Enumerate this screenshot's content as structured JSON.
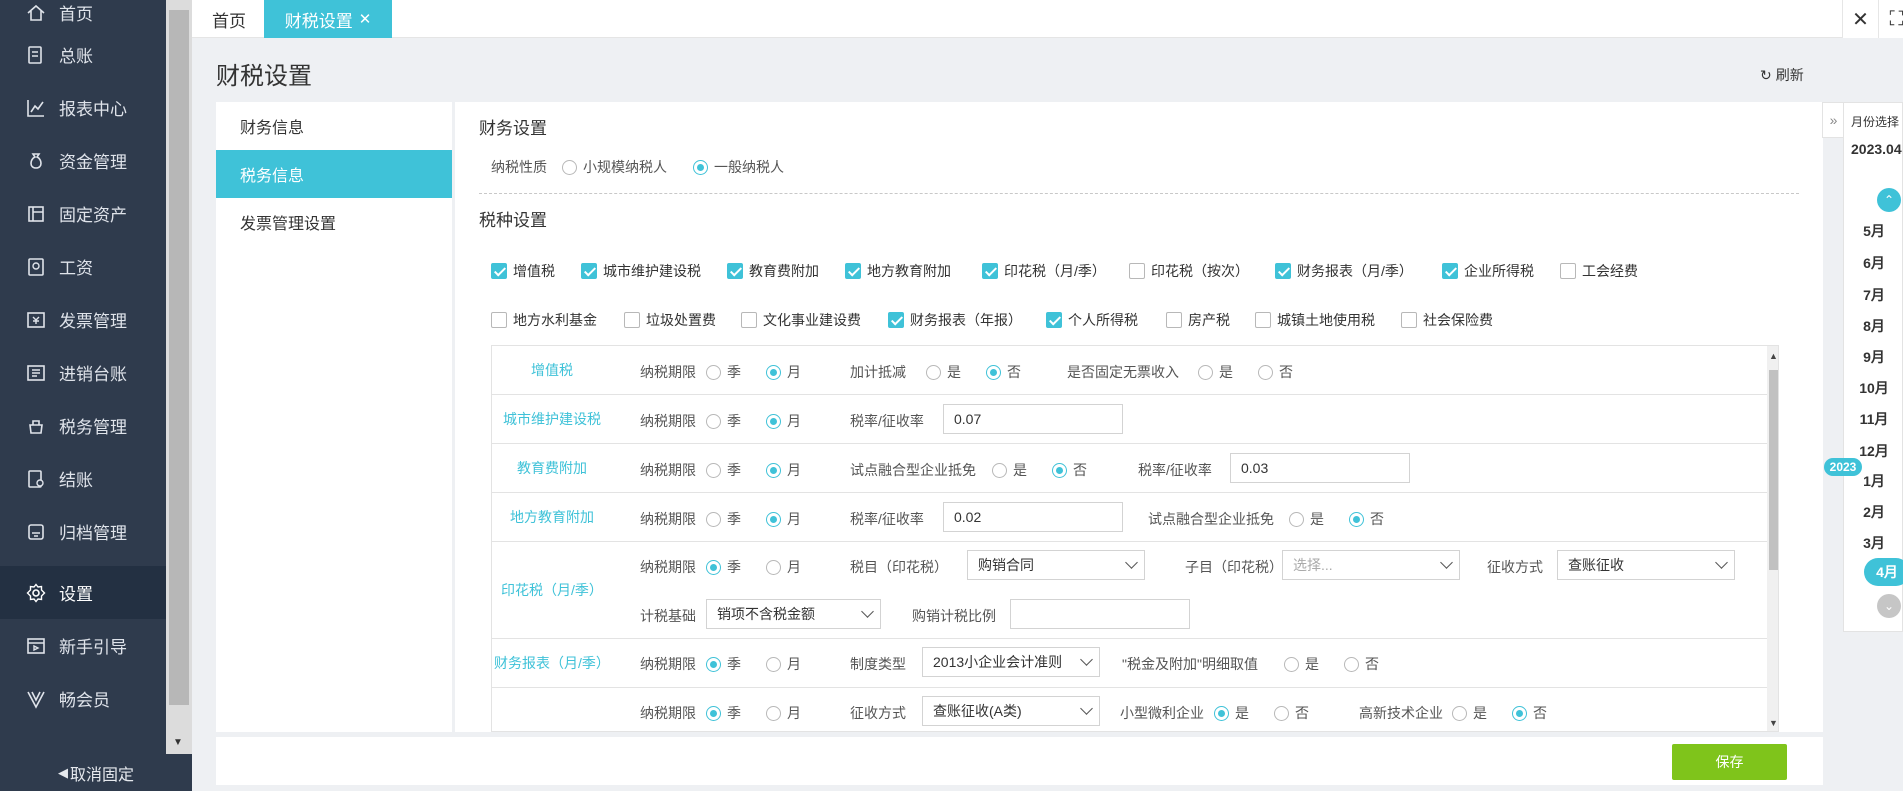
{
  "sidebar": {
    "items": [
      {
        "label": "首页",
        "icon": "home-icon"
      },
      {
        "label": "总账",
        "icon": "ledger-icon"
      },
      {
        "label": "报表中心",
        "icon": "chart-icon"
      },
      {
        "label": "资金管理",
        "icon": "money-bag-icon"
      },
      {
        "label": "固定资产",
        "icon": "asset-icon"
      },
      {
        "label": "工资",
        "icon": "salary-icon"
      },
      {
        "label": "发票管理",
        "icon": "invoice-icon"
      },
      {
        "label": "进销台账",
        "icon": "inventory-icon"
      },
      {
        "label": "税务管理",
        "icon": "tax-icon"
      },
      {
        "label": "结账",
        "icon": "checkout-icon"
      },
      {
        "label": "归档管理",
        "icon": "archive-icon"
      },
      {
        "label": "设置",
        "icon": "gear-icon"
      },
      {
        "label": "新手引导",
        "icon": "guide-icon"
      },
      {
        "label": "畅会员",
        "icon": "vip-icon"
      }
    ],
    "footer": "取消固定"
  },
  "tabs": {
    "home": "首页",
    "active": "财税设置"
  },
  "page": {
    "title": "财税设置",
    "refresh": "刷新"
  },
  "left_nav": [
    "财务信息",
    "税务信息",
    "发票管理设置"
  ],
  "finance": {
    "title": "财务设置",
    "tax_nature_label": "纳税性质",
    "options": [
      "小规模纳税人",
      "一般纳税人"
    ]
  },
  "tax_types": {
    "title": "税种设置",
    "row1": [
      {
        "label": "增值税",
        "checked": true
      },
      {
        "label": "城市维护建设税",
        "checked": true
      },
      {
        "label": "教育费附加",
        "checked": true
      },
      {
        "label": "地方教育附加",
        "checked": true
      },
      {
        "label": "印花税（月/季）",
        "checked": true
      },
      {
        "label": "印花税（按次）",
        "checked": false
      },
      {
        "label": "财务报表（月/季）",
        "checked": true
      },
      {
        "label": "企业所得税",
        "checked": true
      },
      {
        "label": "工会经费",
        "checked": false
      }
    ],
    "row2": [
      {
        "label": "地方水利基金",
        "checked": false
      },
      {
        "label": "垃圾处置费",
        "checked": false
      },
      {
        "label": "文化事业建设费",
        "checked": false
      },
      {
        "label": "财务报表（年报）",
        "checked": true
      },
      {
        "label": "个人所得税",
        "checked": true
      },
      {
        "label": "房产税",
        "checked": false
      },
      {
        "label": "城镇土地使用税",
        "checked": false
      },
      {
        "label": "社会保险费",
        "checked": false
      }
    ]
  },
  "common": {
    "period": "纳税期限",
    "season": "季",
    "month": "月",
    "yes": "是",
    "no": "否",
    "rate": "税率/征收率"
  },
  "rows": {
    "vat": {
      "name": "增值税",
      "plus_deduct": "加计抵减",
      "fixed_no_invoice": "是否固定无票收入"
    },
    "city": {
      "name": "城市维护建设税",
      "rate_value": "0.07"
    },
    "edu": {
      "name": "教育费附加",
      "pilot": "试点融合型企业抵免",
      "rate_value": "0.03"
    },
    "local_edu": {
      "name": "地方教育附加",
      "rate_value": "0.02",
      "pilot": "试点融合型企业抵免"
    },
    "stamp": {
      "name": "印花税（月/季）",
      "item_label": "税目（印花税）",
      "item_value": "购销合同",
      "sub_label": "子目（印花税）",
      "sub_placeholder": "选择...",
      "method_label": "征收方式",
      "method_value": "查账征收",
      "base_label": "计税基础",
      "base_value": "销项不含税金额",
      "ratio_label": "购销计税比例"
    },
    "report": {
      "name": "财务报表（月/季）",
      "system_label": "制度类型",
      "system_value": "2013小企业会计准则",
      "detail_label": "\"税金及附加\"明细取值"
    },
    "cit": {
      "method_label": "征收方式",
      "method_value": "查账征收(A类)",
      "small_label": "小型微利企业",
      "hightech_label": "高新技术企业"
    }
  },
  "month_panel": {
    "title": "月份选择",
    "year": "2023.04",
    "months": [
      "5月",
      "6月",
      "7月",
      "8月",
      "9月",
      "10月",
      "11月",
      "12月",
      "1月",
      "2月",
      "3月",
      "4月"
    ],
    "year_badge": "2023"
  },
  "save": "保存",
  "colors": {
    "accent": "#3fc2d8",
    "sidebar": "#2f3b4d",
    "save": "#7fc41b"
  }
}
